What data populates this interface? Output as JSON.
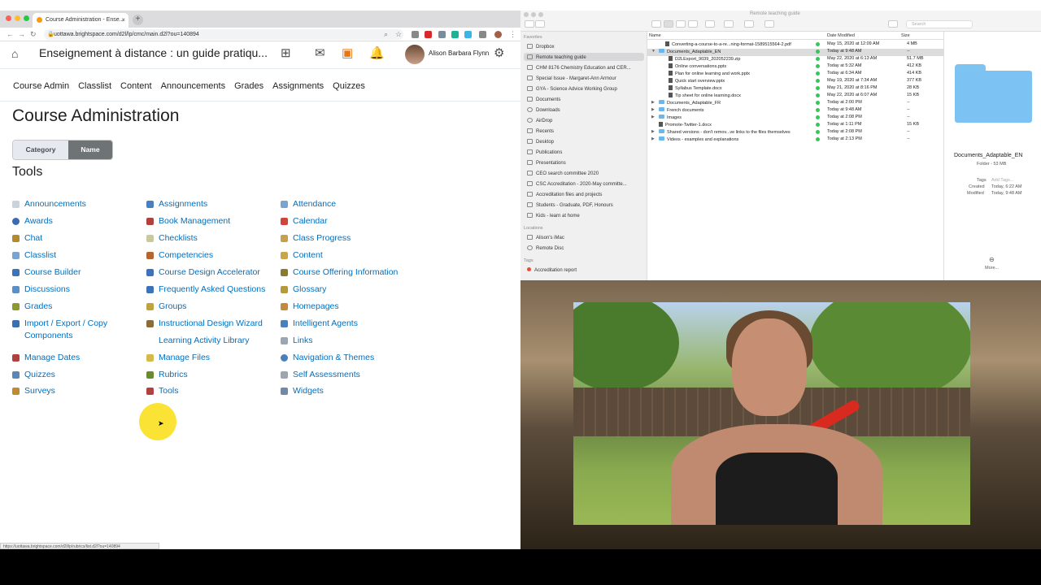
{
  "browser": {
    "tab_title": "Course Administration - Ense...",
    "url": "uottawa.brightspace.com/d2l/lp/cmc/main.d2l?ou=140894",
    "status_url": "https://uottawa.brightspace.com/d2l/lp/rubrics/list.d2l?ou=140894"
  },
  "d2l": {
    "course_title": "Enseignement à distance : un guide pratiqu...",
    "user_name": "Alison Barbara Flynn",
    "nav": [
      "Course Admin",
      "Classlist",
      "Content",
      "Announcements",
      "Grades",
      "Assignments",
      "Quizzes"
    ],
    "page_title": "Course Administration",
    "toggle": {
      "category": "Category",
      "name": "Name"
    },
    "tools_heading": "Tools",
    "tools_col1": [
      "Announcements",
      "Awards",
      "Chat",
      "Classlist",
      "Course Builder",
      "Discussions",
      "Grades",
      "Import / Export / Copy Components",
      "Manage Dates",
      "Quizzes",
      "Surveys"
    ],
    "tools_col2": [
      "Assignments",
      "Book Management",
      "Checklists",
      "Competencies",
      "Course Design Accelerator",
      "Frequently Asked Questions",
      "Groups",
      "Instructional Design Wizard",
      "Learning Activity Library",
      "Manage Files",
      "Rubrics",
      "Tools"
    ],
    "tools_col3": [
      "Attendance",
      "Calendar",
      "Class Progress",
      "Content",
      "Course Offering Information",
      "Glossary",
      "Homepages",
      "Intelligent Agents",
      "Links",
      "Navigation & Themes",
      "Self Assessments",
      "Widgets"
    ]
  },
  "finder": {
    "window_title": "Remote teaching guide",
    "search_placeholder": "Search",
    "favorites_label": "Favorites",
    "locations_label": "Locations",
    "tags_label": "Tags",
    "favorites": [
      "Dropbox",
      "Remote teaching guide",
      "CHM 8176 Chemistry Education and CER...",
      "Special Issue - Margaret-Ann Armour",
      "GYA - Science Advice Working Group",
      "Documents",
      "Downloads",
      "AirDrop",
      "Recents",
      "Desktop",
      "Publications",
      "Presentations",
      "CEO search committee 2020",
      "CSC Accreditation - 2020-May committe...",
      "Accreditation files and projects",
      "Students - Graduate, PDF, Honours",
      "Kids - learn at home"
    ],
    "locations": [
      "Alison's iMac",
      "Remote Disc"
    ],
    "tags": [
      "Accreditation report"
    ],
    "headers": {
      "name": "Name",
      "date": "Date Modified",
      "size": "Size"
    },
    "files": [
      {
        "name": "Converting-a-course-to-a-re...ning-format-1589515564-2.pdf",
        "date": "May 15, 2020 at 12:09 AM",
        "size": "4 MB"
      },
      {
        "name": "Documents_Adaptable_EN",
        "date": "Today at 9:48 AM",
        "size": "--"
      },
      {
        "name": "D2LExport_9039_202052239.zip",
        "date": "May 22, 2020 at 6:13 AM",
        "size": "51.7 MB"
      },
      {
        "name": "Online conversations.pptx",
        "date": "Today at 5:32 AM",
        "size": "412 KB"
      },
      {
        "name": "Plan for online learning and work.pptx",
        "date": "Today at 6:34 AM",
        "size": "414 KB"
      },
      {
        "name": "Quick start overview.pptx",
        "date": "May 19, 2020 at 7:34 AM",
        "size": "377 KB"
      },
      {
        "name": "Syllabus Template.docx",
        "date": "May 21, 2020 at 8:16 PM",
        "size": "28 KB"
      },
      {
        "name": "Tip sheet for online learning.docx",
        "date": "May 22, 2020 at 6:07 AM",
        "size": "15 KB"
      },
      {
        "name": "Documents_Adaptable_FR",
        "date": "Today at 2:00 PM",
        "size": "--"
      },
      {
        "name": "French documents",
        "date": "Today at 9:48 AM",
        "size": "--"
      },
      {
        "name": "Images",
        "date": "Today at 2:08 PM",
        "size": "--"
      },
      {
        "name": "Promote-Twitter-1.docx",
        "date": "Today at 1:11 PM",
        "size": "15 KB"
      },
      {
        "name": "Shared versions - don't remov...ve links to the files themselves",
        "date": "Today at 2:08 PM",
        "size": "--"
      },
      {
        "name": "Videos - examples and explanations",
        "date": "Today at 2:13 PM",
        "size": "--"
      }
    ],
    "preview": {
      "name": "Documents_Adaptable_EN",
      "kind": "Folder - 53 MB",
      "tags_label": "Tags",
      "tags_placeholder": "Add Tags...",
      "created_label": "Created",
      "created": "Today, 6:22 AM",
      "modified_label": "Modified",
      "modified": "Today, 9:48 AM",
      "more": "More..."
    }
  }
}
